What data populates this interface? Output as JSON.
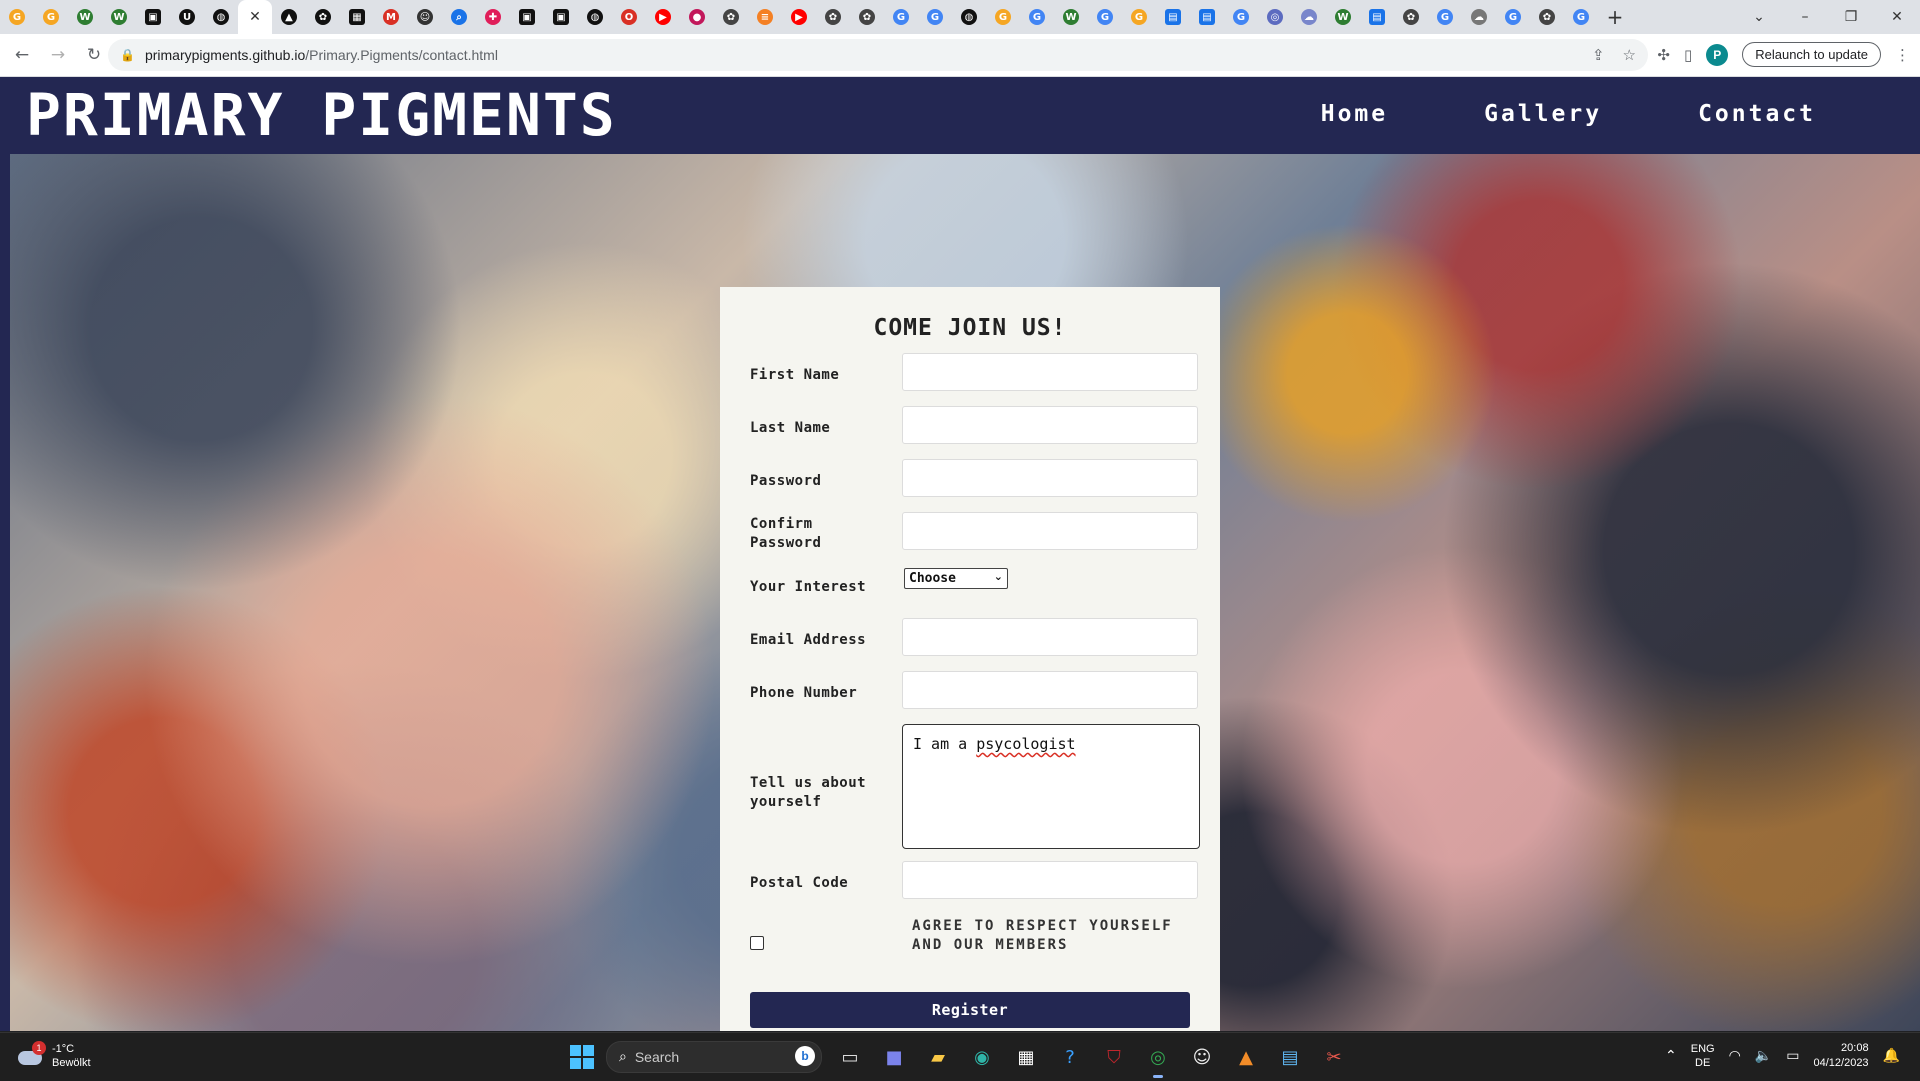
{
  "browser": {
    "tabs": [
      {
        "icon": "g-icon",
        "color": "#f5a623"
      },
      {
        "icon": "g-icon",
        "color": "#f5a623"
      },
      {
        "icon": "w-icon",
        "color": "#2e7d32"
      },
      {
        "icon": "w-icon",
        "color": "#2e7d32"
      },
      {
        "icon": "doc-icon",
        "color": "#111111"
      },
      {
        "icon": "u-icon",
        "color": "#111111"
      },
      {
        "icon": "github-icon",
        "color": "#111111"
      },
      {
        "icon": "close-icon",
        "color": "#333333",
        "active": true
      },
      {
        "icon": "hat-icon",
        "color": "#111111"
      },
      {
        "icon": "openai-icon",
        "color": "#111111"
      },
      {
        "icon": "box-icon",
        "color": "#111111"
      },
      {
        "icon": "gmail-icon",
        "color": "#d93025"
      },
      {
        "icon": "smile-icon",
        "color": "#333333"
      },
      {
        "icon": "search-icon",
        "color": "#1a73e8"
      },
      {
        "icon": "slack-icon",
        "color": "#e01e5a"
      },
      {
        "icon": "doc-icon",
        "color": "#111111"
      },
      {
        "icon": "doc-icon",
        "color": "#111111"
      },
      {
        "icon": "github-icon",
        "color": "#111111"
      },
      {
        "icon": "opera-icon",
        "color": "#d93025"
      },
      {
        "icon": "youtube-icon",
        "color": "#ff0000"
      },
      {
        "icon": "dot-icon",
        "color": "#c2185b"
      },
      {
        "icon": "openai-icon",
        "color": "#444444"
      },
      {
        "icon": "stack-icon",
        "color": "#f48024"
      },
      {
        "icon": "youtube-icon",
        "color": "#ff0000"
      },
      {
        "icon": "openai-icon",
        "color": "#444444"
      },
      {
        "icon": "openai-icon",
        "color": "#444444"
      },
      {
        "icon": "google-icon",
        "color": "#4285f4"
      },
      {
        "icon": "google-icon",
        "color": "#4285f4"
      },
      {
        "icon": "github-icon",
        "color": "#111111"
      },
      {
        "icon": "g-icon",
        "color": "#f5a623"
      },
      {
        "icon": "google-icon",
        "color": "#4285f4"
      },
      {
        "icon": "w-icon",
        "color": "#2e7d32"
      },
      {
        "icon": "google-icon",
        "color": "#4285f4"
      },
      {
        "icon": "g-icon",
        "color": "#f5a623"
      },
      {
        "icon": "docs-icon",
        "color": "#1a73e8"
      },
      {
        "icon": "docs-icon",
        "color": "#1a73e8"
      },
      {
        "icon": "google-icon",
        "color": "#4285f4"
      },
      {
        "icon": "circle-icon",
        "color": "#5c6bc0"
      },
      {
        "icon": "cloud-icon",
        "color": "#7986cb"
      },
      {
        "icon": "w-icon",
        "color": "#2e7d32"
      },
      {
        "icon": "docs-icon",
        "color": "#1a73e8"
      },
      {
        "icon": "openai-icon",
        "color": "#444444"
      },
      {
        "icon": "google-icon",
        "color": "#4285f4"
      },
      {
        "icon": "cloud-icon",
        "color": "#777777"
      },
      {
        "icon": "google-icon",
        "color": "#4285f4"
      },
      {
        "icon": "openai-icon",
        "color": "#444444"
      },
      {
        "icon": "google-icon",
        "color": "#4285f4"
      }
    ],
    "url_host": "primarypigments.github.io",
    "url_path": "/Primary.Pigments/contact.html",
    "relaunch_label": "Relaunch to update",
    "profile_initial": "P"
  },
  "site": {
    "logo": "PRIMARY PIGMENTS",
    "nav": {
      "home": "Home",
      "gallery": "Gallery",
      "contact": "Contact"
    },
    "accent": "#232752"
  },
  "form": {
    "title": "COME JOIN US!",
    "fields": {
      "first_name": {
        "label": "First Name",
        "value": ""
      },
      "last_name": {
        "label": "Last Name",
        "value": ""
      },
      "password": {
        "label": "Password",
        "value": ""
      },
      "confirm_password": {
        "label": "Confirm Password",
        "value": ""
      },
      "interest": {
        "label": "Your Interest",
        "value": "Choose"
      },
      "email": {
        "label": "Email Address",
        "value": ""
      },
      "phone": {
        "label": "Phone Number",
        "value": ""
      },
      "about": {
        "label": "Tell us about yourself",
        "value_prefix": "I am a ",
        "value_misspelled": "psycologist"
      },
      "postal": {
        "label": "Postal Code",
        "value": ""
      }
    },
    "agree_label": "AGREE TO RESPECT YOURSELF AND OUR MEMBERS",
    "agree_checked": false,
    "register_label": "Register"
  },
  "taskbar": {
    "weather_temp": "-1°C",
    "weather_desc": "Bewölkt",
    "weather_badge": "1",
    "search_placeholder": "Search",
    "lang_top": "ENG",
    "lang_bottom": "DE",
    "time": "20:08",
    "date": "04/12/2023"
  }
}
